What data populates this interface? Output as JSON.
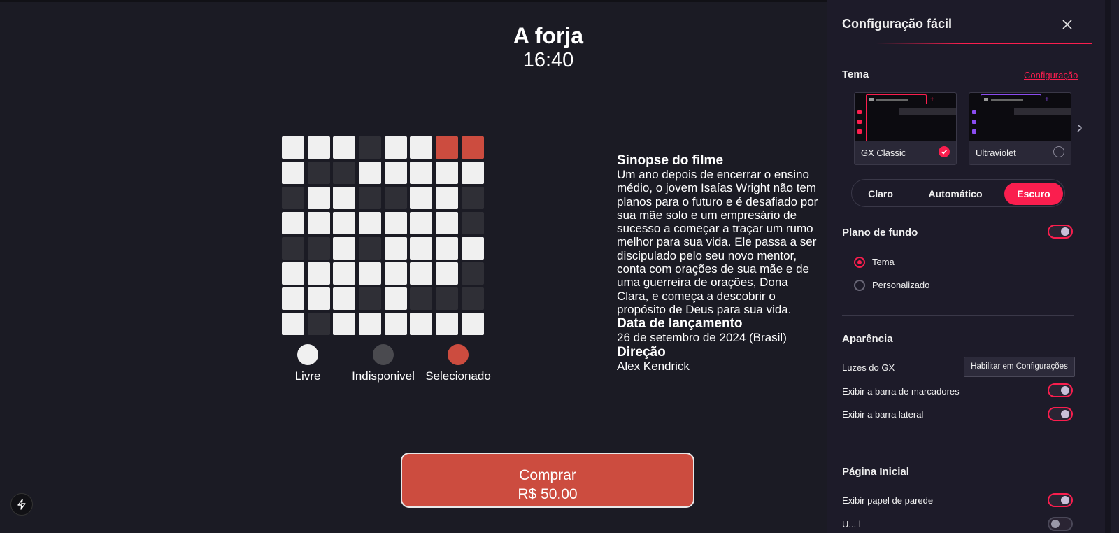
{
  "movie": {
    "title": "A forja",
    "time": "16:40"
  },
  "seats": [
    [
      "livre",
      "livre",
      "livre",
      "indisponivel",
      "livre",
      "livre",
      "selecionado",
      "selecionado"
    ],
    [
      "livre",
      "indisponivel",
      "indisponivel",
      "livre",
      "livre",
      "livre",
      "livre",
      "livre"
    ],
    [
      "indisponivel",
      "livre",
      "livre",
      "indisponivel",
      "indisponivel",
      "livre",
      "livre",
      "indisponivel"
    ],
    [
      "livre",
      "livre",
      "livre",
      "livre",
      "livre",
      "livre",
      "livre",
      "indisponivel"
    ],
    [
      "indisponivel",
      "indisponivel",
      "livre",
      "indisponivel",
      "livre",
      "livre",
      "livre",
      "livre"
    ],
    [
      "livre",
      "livre",
      "livre",
      "livre",
      "livre",
      "livre",
      "livre",
      "indisponivel"
    ],
    [
      "livre",
      "livre",
      "livre",
      "indisponivel",
      "livre",
      "indisponivel",
      "indisponivel",
      "indisponivel"
    ],
    [
      "livre",
      "indisponivel",
      "livre",
      "livre",
      "livre",
      "livre",
      "livre",
      "livre"
    ]
  ],
  "legend": {
    "livre": "Livre",
    "indisponivel": "Indisponivel",
    "selecionado": "Selecionado"
  },
  "colors": {
    "livre": "#f0f0f0",
    "indisponivel": "#4a4a4f",
    "selecionado": "#cc4c3f",
    "accent": "#fa1e4e"
  },
  "details": {
    "synopsis_heading": "Sinopse do filme",
    "synopsis": "Um ano depois de encerrar o ensino médio, o jovem Isaías Wright não tem planos para o futuro e é desafiado por sua mãe solo e um empresário de sucesso a começar a traçar um rumo melhor para sua vida. Ele passa a ser discipulado pelo seu novo mentor, conta com orações de sua mãe e de uma guerreira de orações, Dona Clara, e começa a descobrir o propósito de Deus para sua vida.",
    "release_heading": "Data de lançamento",
    "release": "26 de setembro de 2024 (Brasil)",
    "director_heading": "Direção",
    "director": "Alex Kendrick"
  },
  "buy": {
    "label": "Comprar",
    "price": "R$ 50.00"
  },
  "icons": {
    "bolt": "bolt-icon"
  },
  "panel": {
    "title": "Configuração fácil",
    "theme_label": "Tema",
    "config_link": "Configuração",
    "themes": [
      {
        "name": "GX Classic",
        "selected": true,
        "accent": "#fa1e4e"
      },
      {
        "name": "Ultraviolet",
        "selected": false,
        "accent": "#8b4cf0"
      }
    ],
    "modes": [
      "Claro",
      "Automático",
      "Escuro"
    ],
    "active_mode": "Escuro",
    "background_label": "Plano de fundo",
    "background_enabled": true,
    "background_options": [
      {
        "label": "Tema",
        "selected": true
      },
      {
        "label": "Personalizado",
        "selected": false
      }
    ],
    "appearance_label": "Aparência",
    "gx_lights_label": "Luzes do GX",
    "gx_lights_button": "Habilitar em Configurações",
    "bookmarks_label": "Exibir a barra de marcadores",
    "bookmarks_enabled": true,
    "sidebar_label": "Exibir a barra lateral",
    "sidebar_enabled": true,
    "home_label": "Página Inicial",
    "wallpaper_label": "Exibir papel de parede",
    "wallpaper_enabled": true,
    "partial_label": "U... l",
    "partial_enabled": false
  }
}
